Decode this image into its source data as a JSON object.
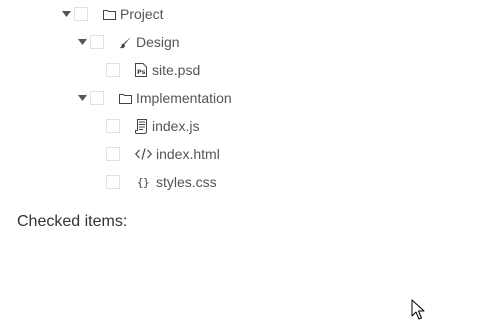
{
  "tree": {
    "project": {
      "label": "Project",
      "icon": "folder-icon"
    },
    "design": {
      "label": "Design",
      "icon": "brush-icon"
    },
    "site_psd": {
      "label": "site.psd",
      "icon": "psd-file-icon",
      "icon_text": "Ps"
    },
    "implementation": {
      "label": "Implementation",
      "icon": "folder-icon"
    },
    "index_js": {
      "label": "index.js",
      "icon": "js-file-icon"
    },
    "index_html": {
      "label": "index.html",
      "icon": "code-icon",
      "icon_text": "</>"
    },
    "styles_css": {
      "label": "styles.css",
      "icon": "css-braces-icon",
      "icon_text": "{}"
    }
  },
  "checked_items_label": "Checked items:"
}
